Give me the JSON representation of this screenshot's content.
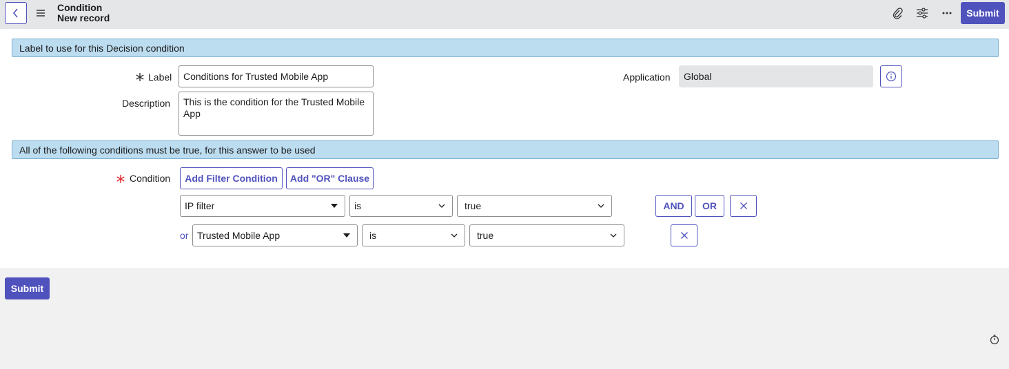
{
  "header": {
    "title": "Condition",
    "subtitle": "New record",
    "submit_label": "Submit"
  },
  "sections": {
    "label_section": "Label to use for this Decision condition",
    "conditions_section": "All of the following conditions must be true, for this answer to be used"
  },
  "fields": {
    "label_label": "Label",
    "label_value": "Conditions for Trusted Mobile App",
    "description_label": "Description",
    "description_value": "This is the condition for the Trusted Mobile App",
    "application_label": "Application",
    "application_value": "Global",
    "condition_label": "Condition"
  },
  "condition_builder": {
    "add_filter_label": "Add Filter Condition",
    "add_or_label": "Add \"OR\" Clause",
    "and_label": "AND",
    "or_button_label": "OR",
    "rows": [
      {
        "prefix": "",
        "field": "IP filter",
        "operator": "is",
        "value": "true"
      },
      {
        "prefix": "or",
        "field": "Trusted Mobile App",
        "operator": "is",
        "value": "true"
      }
    ]
  },
  "footer": {
    "submit_label": "Submit"
  },
  "colors": {
    "accent": "#4f52bd",
    "section_bg": "#bcdcf0",
    "required": "#e0282e"
  }
}
